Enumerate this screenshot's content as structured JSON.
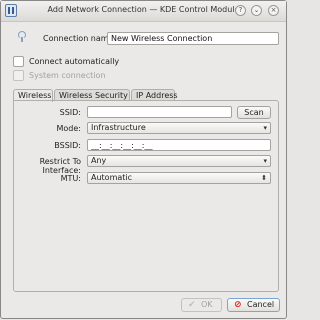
{
  "window": {
    "title": "Add Network Connection — KDE Control Module",
    "help": "?",
    "minimize": "⌄",
    "close": "×"
  },
  "form": {
    "connection_name_label": "Connection name:",
    "connection_name_value": "New Wireless Connection",
    "connect_automatically": {
      "label": "Connect automatically",
      "checked": false
    },
    "system_connection": {
      "label": "System connection",
      "checked": false,
      "enabled": false
    }
  },
  "tabs": [
    {
      "label": "Wireless",
      "active": true
    },
    {
      "label": "Wireless Security",
      "active": false
    },
    {
      "label": "IP Address",
      "active": false
    }
  ],
  "wireless": {
    "ssid_label": "SSID:",
    "ssid_value": "",
    "scan_label": "Scan",
    "mode_label": "Mode:",
    "mode_value": "Infrastructure",
    "bssid_label": "BSSID:",
    "bssid_value": "__:__:__:__:__:__",
    "restrict_label": "Restrict To Interface:",
    "restrict_value": "Any",
    "mtu_label": "MTU:",
    "mtu_value": "Automatic"
  },
  "buttons": {
    "ok": {
      "label": "OK",
      "icon": "check-icon",
      "enabled": false
    },
    "cancel": {
      "label": "Cancel",
      "icon": "cancel-icon",
      "enabled": true
    }
  },
  "colors": {
    "cancel_icon": "#dd2222",
    "focus_border": "#7aa6d6"
  }
}
